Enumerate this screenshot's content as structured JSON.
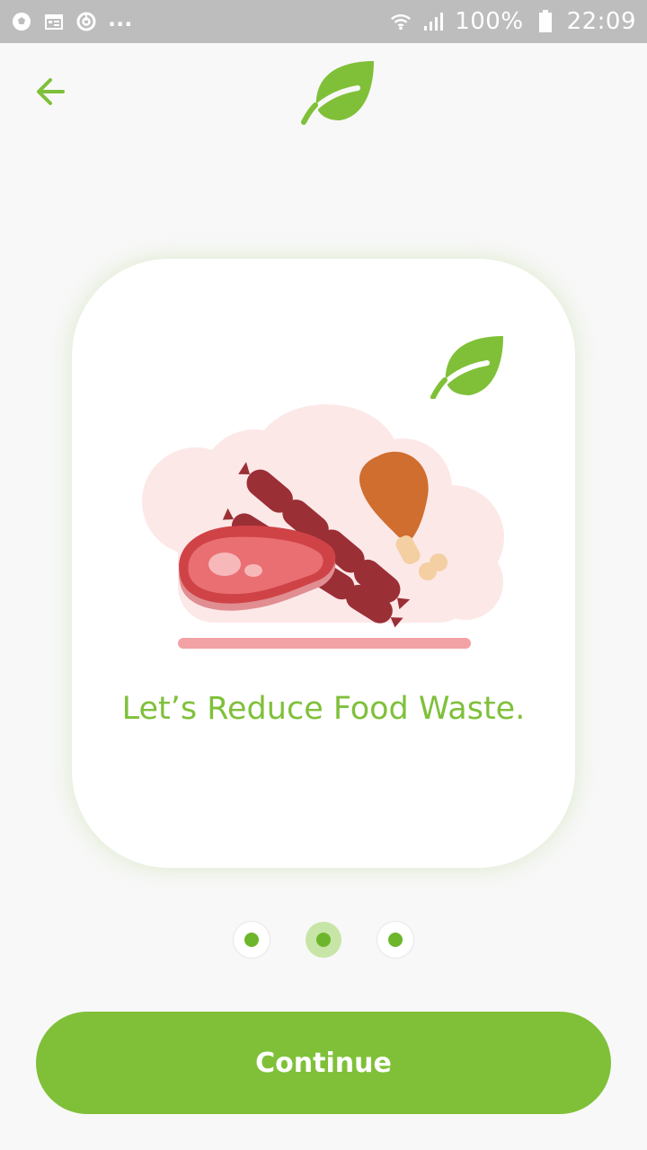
{
  "status_bar": {
    "icons_left": [
      "soccer-ball-icon",
      "calendar-icon",
      "sync-icon"
    ],
    "overflow": "...",
    "icons_right": [
      "wifi-icon",
      "signal-icon",
      "battery-icon"
    ],
    "battery_percent": "100%",
    "time": "22:09"
  },
  "header": {
    "back_icon": "arrow-left-icon",
    "logo_icon": "leaf-icon"
  },
  "card": {
    "logo_icon": "leaf-icon",
    "illustration": "meat-sausage-chicken-illustration",
    "title": "Let’s Reduce Food Waste."
  },
  "pager": {
    "count": 3,
    "active_index": 1
  },
  "continue_button": {
    "label": "Continue"
  },
  "colors": {
    "accent": "#80c038",
    "title_text": "#7fc03a",
    "background": "#f8f8f8",
    "status_bar": "#bdbdbd",
    "card": "#ffffff"
  }
}
